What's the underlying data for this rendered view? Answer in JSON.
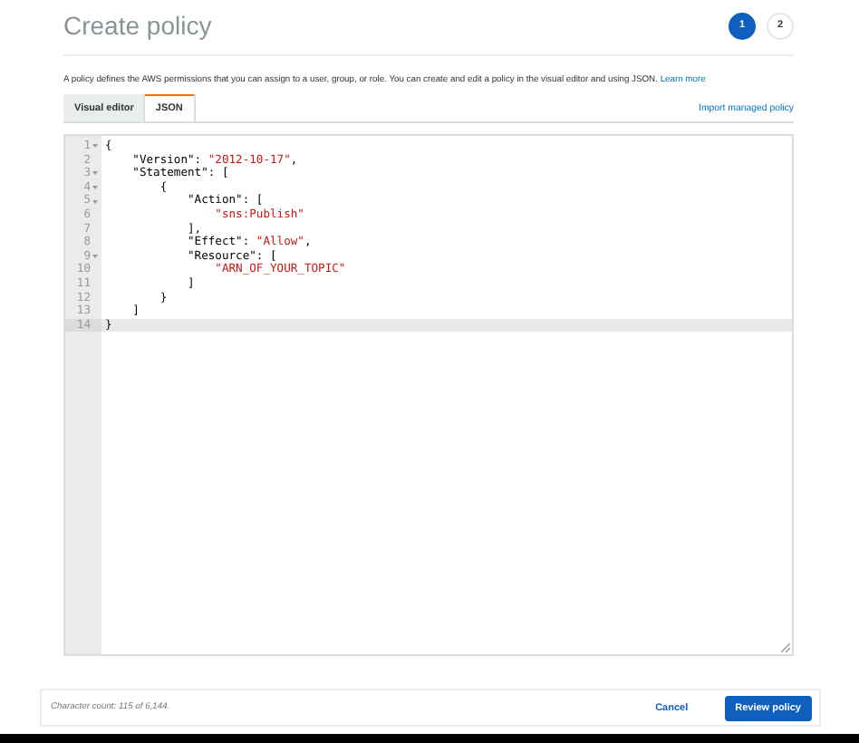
{
  "header": {
    "title": "Create policy",
    "steps": [
      {
        "label": "1",
        "selected": true
      },
      {
        "label": "2",
        "selected": false
      }
    ]
  },
  "description": {
    "text": "A policy defines the AWS permissions that you can assign to a user, group, or role. You can create and edit a policy in the visual editor and using JSON.",
    "link": "Learn more"
  },
  "tabs": [
    {
      "label": "Visual editor",
      "selected": false
    },
    {
      "label": "JSON",
      "selected": true
    }
  ],
  "import_link": "Import managed policy",
  "editor": {
    "lines": [
      {
        "number": "1",
        "foldable": true,
        "active": false,
        "code": [
          {
            "kind": "punct",
            "text": "{"
          }
        ]
      },
      {
        "number": "2",
        "foldable": false,
        "active": false,
        "code": [
          {
            "kind": "punct",
            "text": "    \"Version\": "
          },
          {
            "kind": "string",
            "text": "\"2012-10-17\""
          },
          {
            "kind": "punct",
            "text": ","
          }
        ]
      },
      {
        "number": "3",
        "foldable": true,
        "active": false,
        "code": [
          {
            "kind": "punct",
            "text": "    \"Statement\": ["
          }
        ]
      },
      {
        "number": "4",
        "foldable": true,
        "active": false,
        "code": [
          {
            "kind": "punct",
            "text": "        {"
          }
        ]
      },
      {
        "number": "5",
        "foldable": true,
        "active": false,
        "code": [
          {
            "kind": "punct",
            "text": "            \"Action\": ["
          }
        ]
      },
      {
        "number": "6",
        "foldable": false,
        "active": false,
        "code": [
          {
            "kind": "string",
            "text": "                \"sns:Publish\""
          }
        ]
      },
      {
        "number": "7",
        "foldable": false,
        "active": false,
        "code": [
          {
            "kind": "punct",
            "text": "            ],"
          }
        ]
      },
      {
        "number": "8",
        "foldable": false,
        "active": false,
        "code": [
          {
            "kind": "punct",
            "text": "            \"Effect\": "
          },
          {
            "kind": "string",
            "text": "\"Allow\""
          },
          {
            "kind": "punct",
            "text": ","
          }
        ]
      },
      {
        "number": "9",
        "foldable": true,
        "active": false,
        "code": [
          {
            "kind": "punct",
            "text": "            \"Resource\": ["
          }
        ]
      },
      {
        "number": "10",
        "foldable": false,
        "active": false,
        "code": [
          {
            "kind": "string",
            "text": "                \"ARN_OF_YOUR_TOPIC\""
          }
        ]
      },
      {
        "number": "11",
        "foldable": false,
        "active": false,
        "code": [
          {
            "kind": "punct",
            "text": "            ]"
          }
        ]
      },
      {
        "number": "12",
        "foldable": false,
        "active": false,
        "code": [
          {
            "kind": "punct",
            "text": "        }"
          }
        ]
      },
      {
        "number": "13",
        "foldable": false,
        "active": false,
        "code": [
          {
            "kind": "punct",
            "text": "    ]"
          }
        ]
      },
      {
        "number": "14",
        "foldable": false,
        "active": true,
        "code": [
          {
            "kind": "punct",
            "text": "}"
          }
        ]
      }
    ]
  },
  "footer": {
    "character_count": "Character count: 115 of 6,144.",
    "cancel": "Cancel",
    "review": "Review policy"
  }
}
